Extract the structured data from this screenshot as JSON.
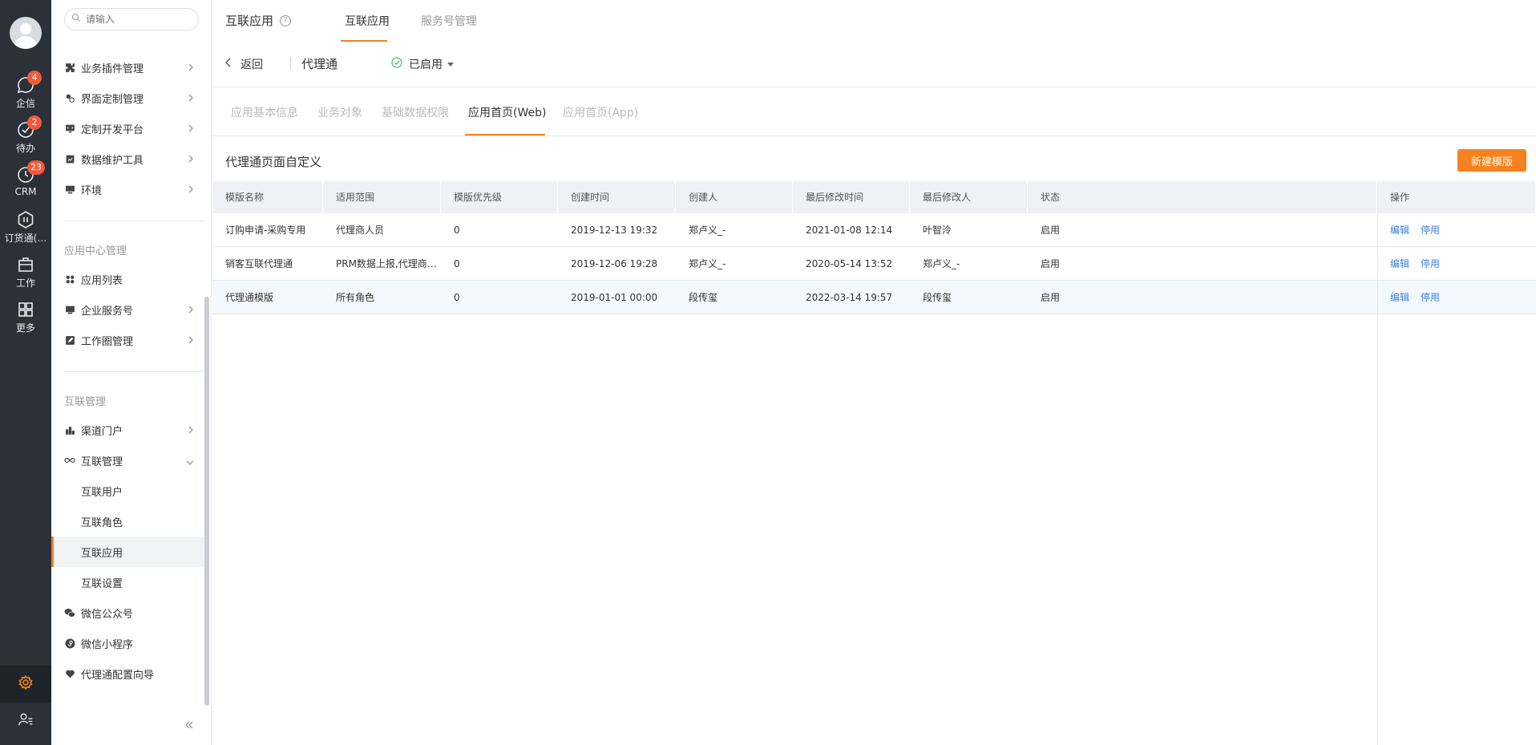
{
  "rail": {
    "items": [
      {
        "label": "企信",
        "badge": "4"
      },
      {
        "label": "待办",
        "badge": "2"
      },
      {
        "label": "CRM",
        "badge": "23"
      },
      {
        "label": "订货通(…",
        "badge": ""
      },
      {
        "label": "工作",
        "badge": ""
      },
      {
        "label": "更多",
        "badge": ""
      }
    ]
  },
  "sidebar": {
    "search_placeholder": "请输入",
    "items_top": [
      {
        "label": "业务插件管理"
      },
      {
        "label": "界面定制管理"
      },
      {
        "label": "定制开发平台"
      },
      {
        "label": "数据维护工具"
      },
      {
        "label": "环境"
      }
    ],
    "group_app_center": "应用中心管理",
    "items_app": [
      {
        "label": "应用列表"
      },
      {
        "label": "企业服务号"
      },
      {
        "label": "工作圈管理"
      }
    ],
    "group_interconnect": "互联管理",
    "items_inter": [
      {
        "label": "渠道门户"
      },
      {
        "label": "互联管理"
      }
    ],
    "sub_items": [
      {
        "label": "互联用户"
      },
      {
        "label": "互联角色"
      },
      {
        "label": "互联应用"
      },
      {
        "label": "互联设置"
      }
    ],
    "items_bottom": [
      {
        "label": "微信公众号"
      },
      {
        "label": "微信小程序"
      },
      {
        "label": "代理通配置向导"
      }
    ]
  },
  "header": {
    "title": "互联应用",
    "help": "?",
    "tabs": [
      {
        "label": "互联应用"
      },
      {
        "label": "服务号管理"
      }
    ]
  },
  "subbar": {
    "back_label": "返回",
    "app_name": "代理通",
    "status": "已启用"
  },
  "section_tabs": [
    {
      "label": "应用基本信息"
    },
    {
      "label": "业务对象"
    },
    {
      "label": "基础数据权限"
    },
    {
      "label": "应用首页(Web)"
    },
    {
      "label": "应用首页(App)"
    }
  ],
  "section": {
    "title": "代理通页面自定义",
    "new_button": "新建模版"
  },
  "table": {
    "columns": [
      "模版名称",
      "适用范围",
      "模版优先级",
      "创建时间",
      "创建人",
      "最后修改时间",
      "最后修改人",
      "状态",
      "操作"
    ],
    "rows": [
      {
        "name": "订购申请-采购专用",
        "scope": "代理商人员",
        "priority": "0",
        "created": "2019-12-13 19:32",
        "creator": "郑卢义_-",
        "modified": "2021-01-08 12:14",
        "modifier": "叶智泠",
        "status": "启用",
        "edit": "编辑",
        "disable": "停用"
      },
      {
        "name": "销客互联代理通",
        "scope": "PRM数据上报,代理商…",
        "priority": "0",
        "created": "2019-12-06 19:28",
        "creator": "郑卢义_-",
        "modified": "2020-05-14 13:52",
        "modifier": "郑卢义_-",
        "status": "启用",
        "edit": "编辑",
        "disable": "停用"
      },
      {
        "name": "代理通模版",
        "scope": "所有角色",
        "priority": "0",
        "created": "2019-01-01 00:00",
        "creator": "段传玺",
        "modified": "2022-03-14 19:57",
        "modifier": "段传玺",
        "status": "启用",
        "edit": "编辑",
        "disable": "停用"
      }
    ]
  },
  "colors": {
    "accent": "#f5821f",
    "link": "#3a7fdc",
    "rail": "#2b3039",
    "badge": "#f15a3b"
  }
}
